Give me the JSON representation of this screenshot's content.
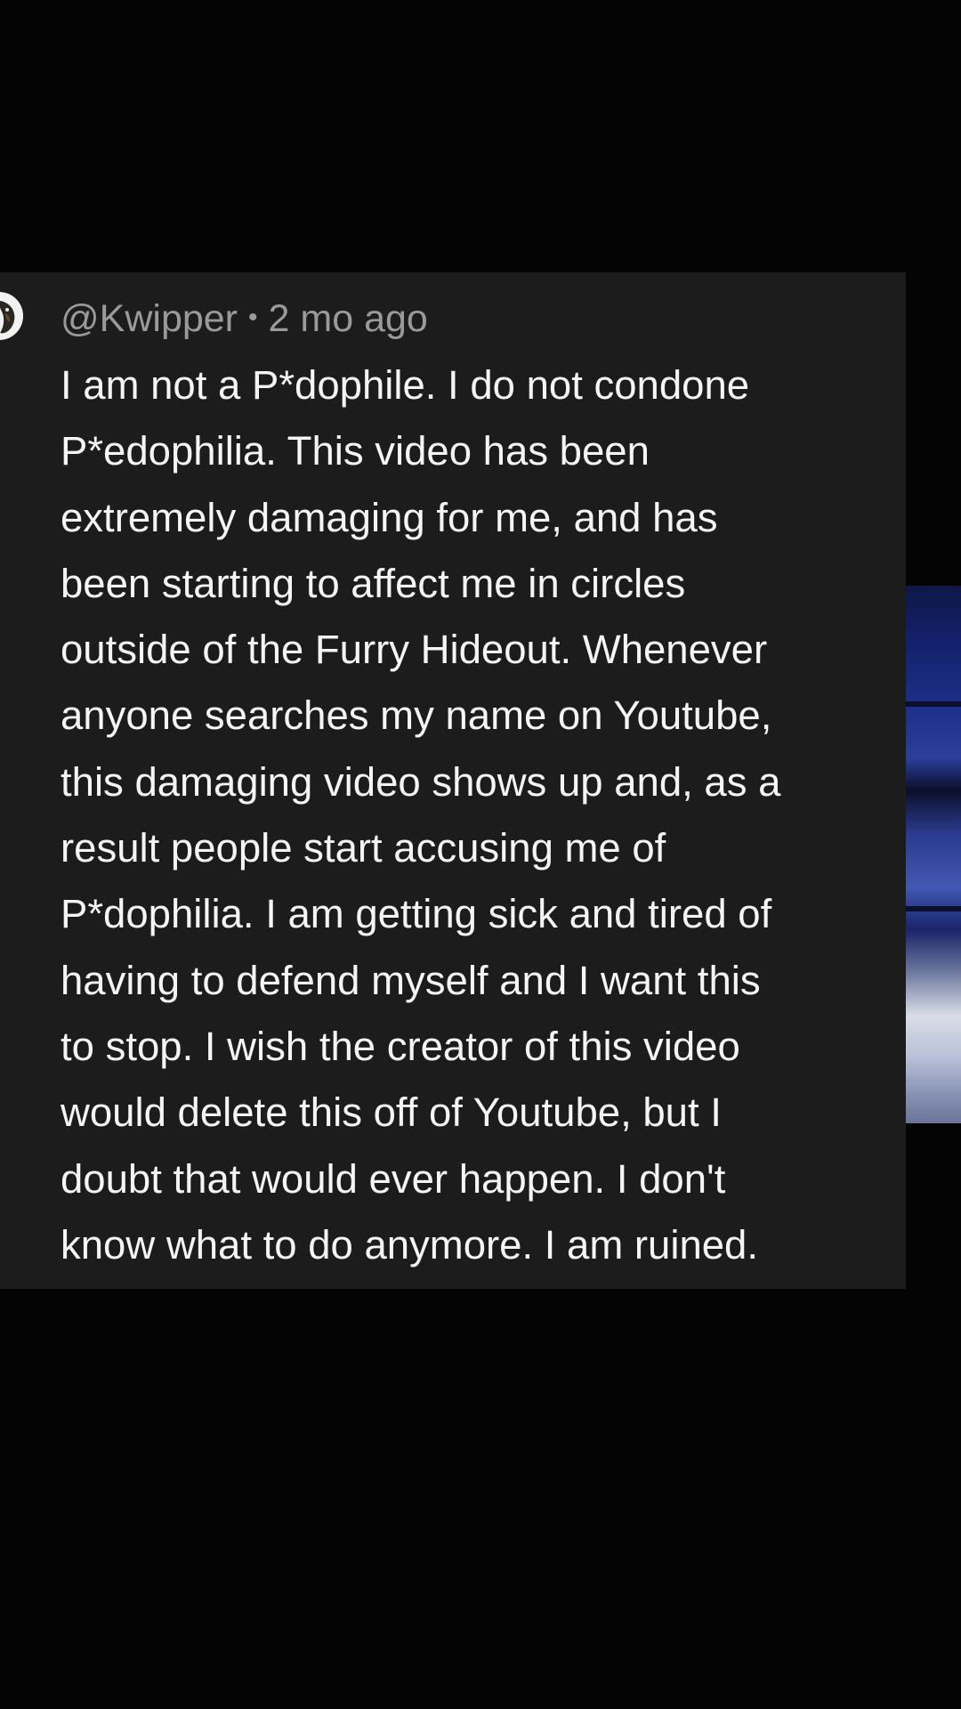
{
  "comment": {
    "author": "@Kwipper",
    "separator": "•",
    "timestamp": "2 mo ago",
    "avatar_icon": "avatar-icon",
    "body_lines": [
      "I am not a P*dophile. I do not condone",
      "P*edophilia. This video has been",
      "extremely damaging for me, and has",
      "been starting to affect me in circles",
      "outside of the Furry Hideout. Whenever",
      "anyone searches my name on Youtube,",
      "this damaging video shows up and, as a",
      "result people start accusing me of",
      "P*dophilia. I am getting sick and tired of",
      "having to defend myself and I want this",
      "to stop. I wish the creator of this video",
      "would delete this off of Youtube, but I",
      "doubt that would ever happen. I don't",
      "know what to do anymore. I am ruined."
    ]
  },
  "colors": {
    "background": "#040404",
    "card": "#1c1c1c",
    "body_text": "#f5f5f5",
    "meta_text": "#9a9a9a"
  }
}
